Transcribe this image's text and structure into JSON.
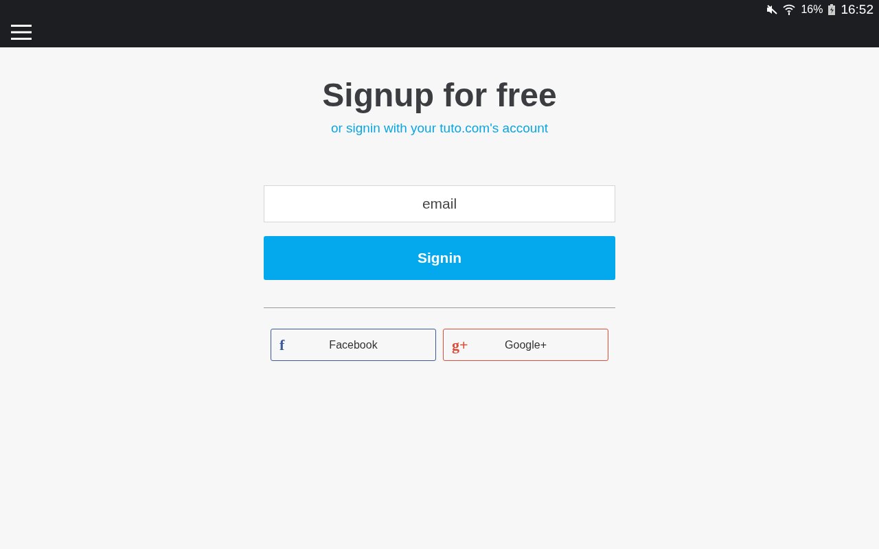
{
  "status_bar": {
    "battery": "16%",
    "time": "16:52"
  },
  "title": "Signup for free",
  "subtitle": "or signin with your tuto.com's account",
  "email_field": {
    "placeholder": "email"
  },
  "submit_button": "Signin",
  "social_buttons": [
    {
      "glyph": "f",
      "label": "Facebook",
      "color": "#3b5998"
    },
    {
      "glyph": "g+",
      "label": "Google+",
      "color": "#dd4b39"
    }
  ]
}
